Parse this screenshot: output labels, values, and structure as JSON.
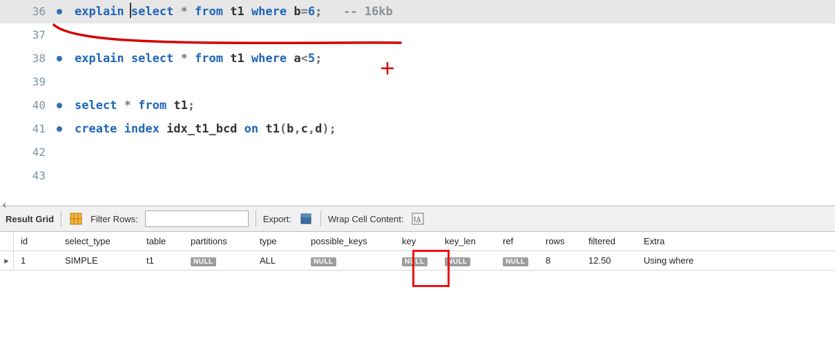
{
  "editor": {
    "lines": [
      {
        "num": "36",
        "has_dot": true,
        "hl": true,
        "tokens": [
          [
            "kw",
            "explain "
          ],
          [
            "caret",
            ""
          ],
          [
            "kw",
            "select "
          ],
          [
            "op",
            "* "
          ],
          [
            "kw",
            "from "
          ],
          [
            "id",
            "t1 "
          ],
          [
            "kw",
            "where "
          ],
          [
            "id",
            "b"
          ],
          [
            "op",
            "="
          ],
          [
            "num",
            "6"
          ],
          [
            "punc",
            ";   "
          ],
          [
            "cmt",
            "-- 16kb"
          ]
        ]
      },
      {
        "num": "37",
        "has_dot": false,
        "hl": false,
        "tokens": []
      },
      {
        "num": "38",
        "has_dot": true,
        "hl": false,
        "tokens": [
          [
            "kw",
            "explain select "
          ],
          [
            "op",
            "* "
          ],
          [
            "kw",
            "from "
          ],
          [
            "id",
            "t1 "
          ],
          [
            "kw",
            "where "
          ],
          [
            "id",
            "a"
          ],
          [
            "op",
            "<"
          ],
          [
            "num",
            "5"
          ],
          [
            "punc",
            ";"
          ]
        ]
      },
      {
        "num": "39",
        "has_dot": false,
        "hl": false,
        "tokens": []
      },
      {
        "num": "40",
        "has_dot": true,
        "hl": false,
        "tokens": [
          [
            "kw",
            "select "
          ],
          [
            "op",
            "* "
          ],
          [
            "kw",
            "from "
          ],
          [
            "id",
            "t1"
          ],
          [
            "punc",
            ";"
          ]
        ]
      },
      {
        "num": "41",
        "has_dot": true,
        "hl": false,
        "tokens": [
          [
            "kw",
            "create index "
          ],
          [
            "id",
            "idx_t1_bcd "
          ],
          [
            "kw",
            "on "
          ],
          [
            "id",
            "t1"
          ],
          [
            "punc",
            "("
          ],
          [
            "id",
            "b"
          ],
          [
            "punc",
            ","
          ],
          [
            "id",
            "c"
          ],
          [
            "punc",
            ","
          ],
          [
            "id",
            "d"
          ],
          [
            "punc",
            ");"
          ]
        ]
      },
      {
        "num": "42",
        "has_dot": false,
        "hl": false,
        "tokens": []
      },
      {
        "num": "43",
        "has_dot": false,
        "hl": false,
        "tokens": []
      }
    ],
    "collapse_handle": "‹"
  },
  "toolbar": {
    "result_grid_label": "Result Grid",
    "filter_label": "Filter Rows:",
    "filter_value": "",
    "export_label": "Export:",
    "wrap_label": "Wrap Cell Content:"
  },
  "grid": {
    "headers": [
      "id",
      "select_type",
      "table",
      "partitions",
      "type",
      "possible_keys",
      "key",
      "key_len",
      "ref",
      "rows",
      "filtered",
      "Extra"
    ],
    "null_label": "NULL",
    "row": {
      "id": "1",
      "select_type": "SIMPLE",
      "table": "t1",
      "partitions": null,
      "type": "ALL",
      "possible_keys": null,
      "key": null,
      "key_len": null,
      "ref": null,
      "rows": "8",
      "filtered": "12.50",
      "Extra": "Using where"
    }
  }
}
